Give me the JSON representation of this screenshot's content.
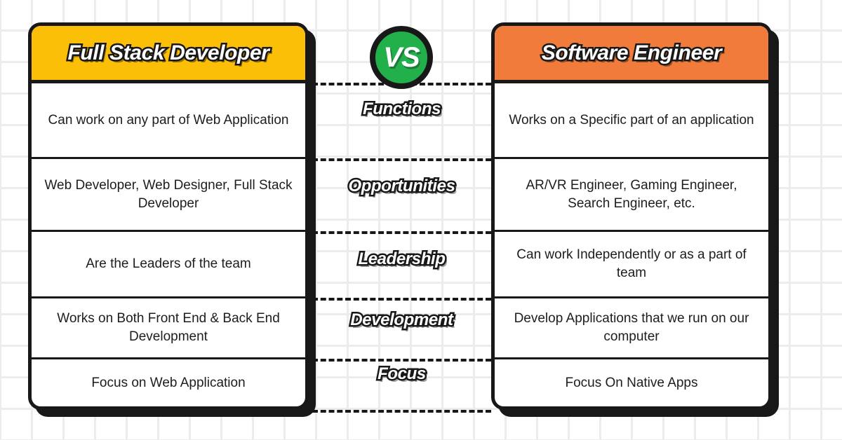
{
  "background": {
    "style": "graph-paper",
    "page_color": "#ffffff",
    "grid_line_color": "#ececec",
    "grid_spacing_px": 45
  },
  "center_badge": {
    "label": "VS",
    "name": "vs-badge",
    "fill_color": "#22B04B",
    "border_color": "#181818"
  },
  "colors": {
    "left_header_bg": "#FBBF08",
    "right_header_bg": "#F07B3A",
    "outline": "#181818",
    "card_bg": "#ffffff",
    "body_text": "#1d1d1d",
    "header_text": "#ffffff"
  },
  "left_column": {
    "title": "Full Stack Developer",
    "header_bg": "#FBBF08",
    "rows": [
      "Can work on any part of Web Application",
      "Web Developer, Web Designer, Full Stack Developer",
      "Are the Leaders of the team",
      "Works on Both Front End & Back End Development",
      "Focus on Web Application"
    ]
  },
  "right_column": {
    "title": "Software Engineer",
    "header_bg": "#F07B3A",
    "rows": [
      "Works on a Specific part of an application",
      "AR/VR Engineer, Gaming Engineer, Search Engineer, etc.",
      "Can work Independently or as a part of team",
      "Develop Applications that we run on our computer",
      "Focus On Native Apps"
    ]
  },
  "criteria": [
    "Functions",
    "Opportunities",
    "Leadership",
    "Development",
    "Focus"
  ]
}
